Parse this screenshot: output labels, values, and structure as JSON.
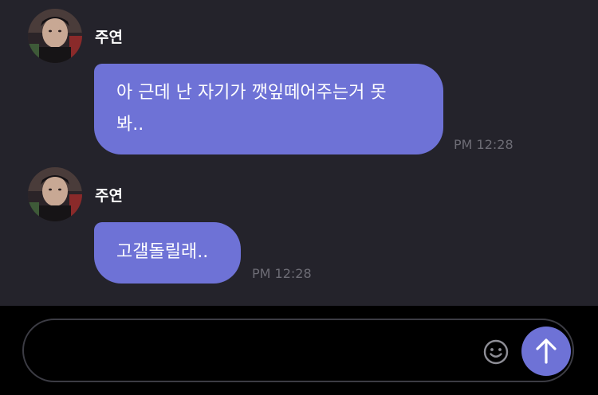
{
  "messages": [
    {
      "sender": "주연",
      "text_lines": [
        "아 근데 난 자기가 깻잎떼어주는거 못",
        "봐.."
      ],
      "time": "PM 12:28"
    },
    {
      "sender": "주연",
      "text_lines": [
        "고갤돌릴래.."
      ],
      "time": "PM 12:28"
    }
  ],
  "composer": {
    "value": "",
    "placeholder": "",
    "emoji_icon": "smiley-icon",
    "send_icon": "arrow-up-icon"
  },
  "colors": {
    "background": "#24232b",
    "bubble": "#6e72d6",
    "timestamp": "#6d6c75",
    "composer_bg": "#000000",
    "send_button": "#6e72d6"
  }
}
